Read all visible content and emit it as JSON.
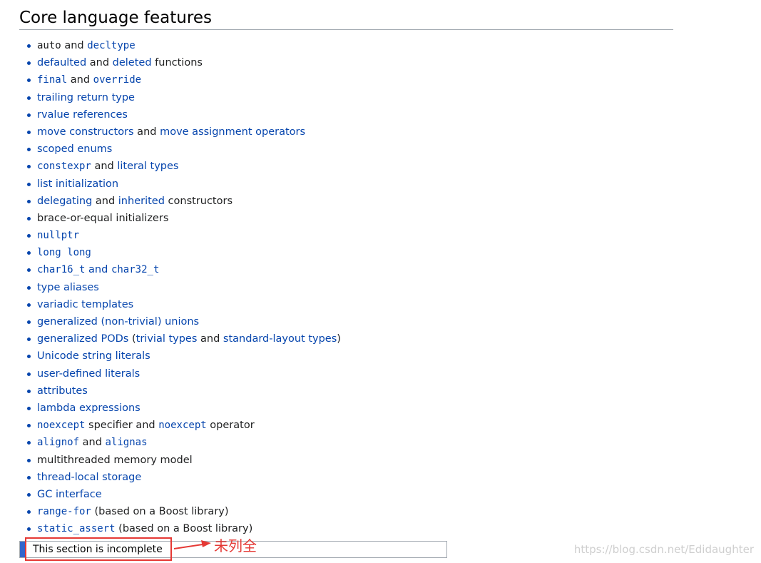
{
  "heading": "Core language features",
  "features": [
    [
      {
        "t": "auto",
        "cls": "code txt"
      },
      {
        "t": " and ",
        "cls": "txt"
      },
      {
        "t": "decltype",
        "cls": "code lnk"
      }
    ],
    [
      {
        "t": "defaulted",
        "cls": "lnk"
      },
      {
        "t": " and ",
        "cls": "txt"
      },
      {
        "t": "deleted",
        "cls": "lnk"
      },
      {
        "t": " functions",
        "cls": "txt"
      }
    ],
    [
      {
        "t": "final",
        "cls": "code lnk"
      },
      {
        "t": " and ",
        "cls": "txt"
      },
      {
        "t": "override",
        "cls": "code lnk"
      }
    ],
    [
      {
        "t": "trailing return type",
        "cls": "lnk"
      }
    ],
    [
      {
        "t": "rvalue references",
        "cls": "lnk"
      }
    ],
    [
      {
        "t": "move constructors",
        "cls": "lnk"
      },
      {
        "t": " and ",
        "cls": "txt"
      },
      {
        "t": "move assignment operators",
        "cls": "lnk"
      }
    ],
    [
      {
        "t": "scoped enums",
        "cls": "lnk"
      }
    ],
    [
      {
        "t": "constexpr",
        "cls": "code lnk"
      },
      {
        "t": " and ",
        "cls": "txt"
      },
      {
        "t": "literal types",
        "cls": "lnk"
      }
    ],
    [
      {
        "t": "list initialization",
        "cls": "lnk"
      }
    ],
    [
      {
        "t": "delegating",
        "cls": "lnk"
      },
      {
        "t": " and ",
        "cls": "txt"
      },
      {
        "t": "inherited",
        "cls": "lnk"
      },
      {
        "t": " constructors",
        "cls": "txt"
      }
    ],
    [
      {
        "t": "brace-or-equal initializers",
        "cls": "txt"
      }
    ],
    [
      {
        "t": "nullptr",
        "cls": "code lnk"
      }
    ],
    [
      {
        "t": "long long",
        "cls": "code lnk"
      }
    ],
    [
      {
        "t": "char16_t",
        "cls": "code lnk"
      },
      {
        "t": " and ",
        "cls": "lnk"
      },
      {
        "t": "char32_t",
        "cls": "code lnk"
      }
    ],
    [
      {
        "t": "type aliases",
        "cls": "lnk"
      }
    ],
    [
      {
        "t": "variadic templates",
        "cls": "lnk"
      }
    ],
    [
      {
        "t": "generalized (non-trivial) unions",
        "cls": "lnk"
      }
    ],
    [
      {
        "t": "generalized PODs",
        "cls": "lnk"
      },
      {
        "t": " (",
        "cls": "txt"
      },
      {
        "t": "trivial types",
        "cls": "lnk"
      },
      {
        "t": " and ",
        "cls": "txt"
      },
      {
        "t": "standard-layout types",
        "cls": "lnk"
      },
      {
        "t": ")",
        "cls": "txt"
      }
    ],
    [
      {
        "t": "Unicode string literals",
        "cls": "lnk"
      }
    ],
    [
      {
        "t": "user-defined literals",
        "cls": "lnk"
      }
    ],
    [
      {
        "t": "attributes",
        "cls": "lnk"
      }
    ],
    [
      {
        "t": "lambda expressions",
        "cls": "lnk"
      }
    ],
    [
      {
        "t": "noexcept",
        "cls": "code lnk"
      },
      {
        "t": " specifier and ",
        "cls": "txt"
      },
      {
        "t": "noexcept",
        "cls": "code lnk"
      },
      {
        "t": " operator",
        "cls": "txt"
      }
    ],
    [
      {
        "t": "alignof",
        "cls": "code lnk"
      },
      {
        "t": " and ",
        "cls": "txt"
      },
      {
        "t": "alignas",
        "cls": "code lnk"
      }
    ],
    [
      {
        "t": "multithreaded memory model",
        "cls": "txt"
      }
    ],
    [
      {
        "t": "thread-local storage",
        "cls": "lnk"
      }
    ],
    [
      {
        "t": "GC interface",
        "cls": "lnk"
      }
    ],
    [
      {
        "t": "range-for",
        "cls": "code lnk"
      },
      {
        "t": " (based on a Boost library)",
        "cls": "txt"
      }
    ],
    [
      {
        "t": "static_assert",
        "cls": "code lnk"
      },
      {
        "t": " (based on a Boost library)",
        "cls": "txt"
      }
    ]
  ],
  "notice": "This section is incomplete",
  "annotation": "未列全",
  "watermark": "https://blog.csdn.net/Edidaughter",
  "colors": {
    "link": "#0645ad",
    "annotation": "#e53935",
    "notice_bar": "#3366cc"
  }
}
